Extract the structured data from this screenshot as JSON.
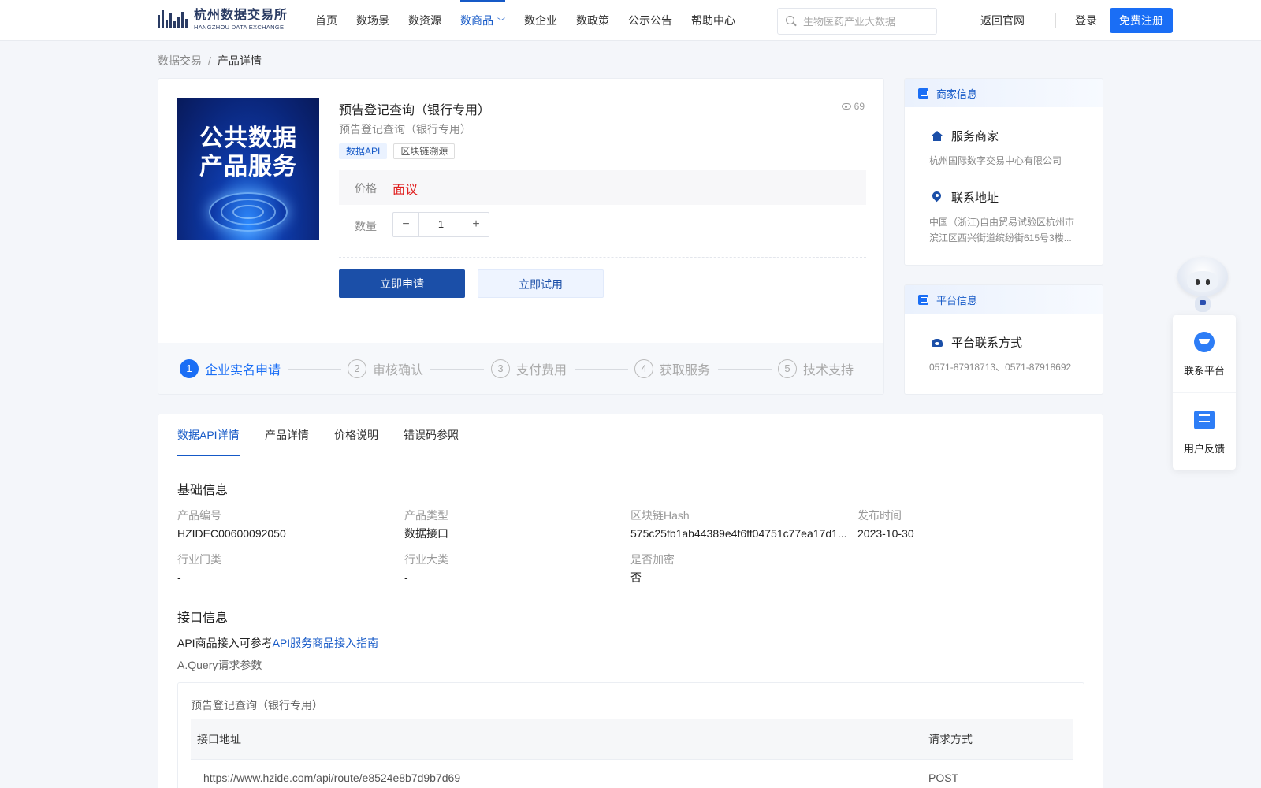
{
  "header": {
    "logo_cn": "杭州数据交易所",
    "logo_en": "HANGZHOU DATA EXCHANGE",
    "nav": [
      {
        "label": "首页"
      },
      {
        "label": "数场景"
      },
      {
        "label": "数资源"
      },
      {
        "label": "数商品",
        "active": true
      },
      {
        "label": "数企业"
      },
      {
        "label": "数政策"
      },
      {
        "label": "公示公告"
      },
      {
        "label": "帮助中心"
      }
    ],
    "search_placeholder": "生物医药产业大数据",
    "back_label": "返回官网",
    "login_label": "登录",
    "register_label": "免费注册",
    "accent_color": "#1a6ef5"
  },
  "breadcrumb": {
    "root": "数据交易",
    "sep": "/",
    "current": "产品详情"
  },
  "product": {
    "image_text_line1": "公共数据",
    "image_text_line2": "产品服务",
    "title": "预告登记查询（银行专用）",
    "subtitle": "预告登记查询（银行专用）",
    "views": "69",
    "tags": [
      "数据API",
      "区块链溯源"
    ],
    "price_label": "价格",
    "price_value": "面议",
    "qty_label": "数量",
    "qty_minus": "−",
    "qty_value": "1",
    "qty_plus": "+",
    "apply_label": "立即申请",
    "trial_label": "立即试用"
  },
  "steps": [
    {
      "num": "1",
      "label": "企业实名申请",
      "active": true
    },
    {
      "num": "2",
      "label": "审核确认"
    },
    {
      "num": "3",
      "label": "支付费用"
    },
    {
      "num": "4",
      "label": "获取服务"
    },
    {
      "num": "5",
      "label": "技术支持"
    }
  ],
  "merchant": {
    "head": "商家信息",
    "service_title": "服务商家",
    "service_value": "杭州国际数字交易中心有限公司",
    "address_title": "联系地址",
    "address_value": "中国（浙江)自由贸易试验区杭州市滨江区西兴街道缤纷街615号3楼..."
  },
  "platform": {
    "head": "平台信息",
    "contact_title": "平台联系方式",
    "contact_value": "0571-87918713、0571-87918692"
  },
  "float": {
    "contact": "联系平台",
    "feedback": "用户反馈"
  },
  "details": {
    "tabs": [
      "数据API详情",
      "产品详情",
      "价格说明",
      "错误码参照"
    ],
    "basic_title": "基础信息",
    "fields": [
      {
        "label": "产品编号",
        "value": "HZIDEC00600092050"
      },
      {
        "label": "产品类型",
        "value": "数据接口"
      },
      {
        "label": "区块链Hash",
        "value": "575c25fb1ab44389e4f6ff04751c77ea17d1..."
      },
      {
        "label": "发布时间",
        "value": "2023-10-30"
      },
      {
        "label": "行业门类",
        "value": "-"
      },
      {
        "label": "行业大类",
        "value": "-"
      },
      {
        "label": "是否加密",
        "value": "否"
      }
    ],
    "api_title": "接口信息",
    "api_note_prefix": "API商品接入可参考",
    "api_note_link": "API服务商品接入指南",
    "query_label": "A.Query请求参数",
    "api_box_title": "预告登记查询（银行专用）",
    "table_head": {
      "url": "接口地址",
      "method": "请求方式"
    },
    "table_row": {
      "url": "https://www.hzide.com/api/route/e8524e8b7d9b7d69",
      "method": "POST"
    }
  }
}
